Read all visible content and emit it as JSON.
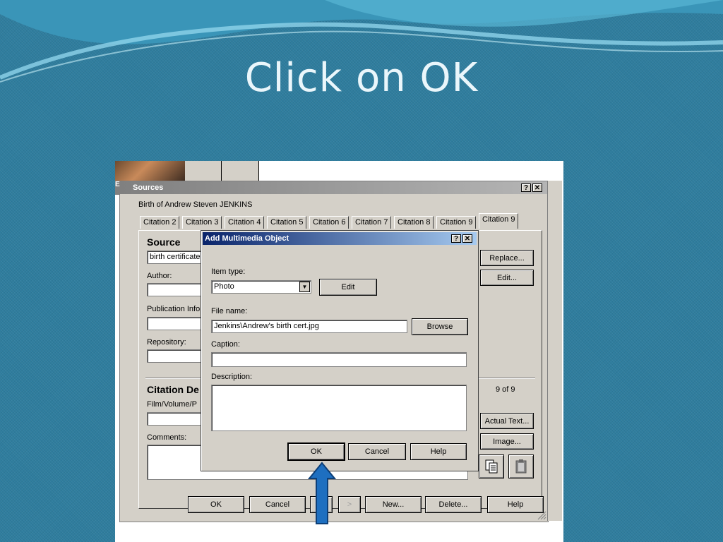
{
  "slide": {
    "title": "Click on OK"
  },
  "sources_dialog": {
    "title": "Sources",
    "help_btn": "?",
    "close_btn": "✕",
    "subtitle": "Birth of Andrew Steven JENKINS",
    "tabs": [
      "Citation 2",
      "Citation 3",
      "Citation 4",
      "Citation 5",
      "Citation 6",
      "Citation 7",
      "Citation 8",
      "Citation 9",
      "Citation 9"
    ],
    "source_heading": "Source",
    "source_value": "birth certificate",
    "author_label": "Author:",
    "publication_label": "Publication Info",
    "repository_label": "Repository:",
    "citation_heading": "Citation De",
    "film_label": "Film/Volume/P",
    "comments_label": "Comments:",
    "replace_btn": "Replace...",
    "edit_btn": "Edit...",
    "count": "9 of 9",
    "actual_text_btn": "Actual Text...",
    "image_btn": "Image...",
    "footer": {
      "ok": "OK",
      "cancel": "Cancel",
      "next": ">",
      "new": "New...",
      "delete": "Delete...",
      "help": "Help"
    },
    "side_letter": "Ed"
  },
  "multimedia_dialog": {
    "title": "Add Multimedia Object",
    "help_btn": "?",
    "close_btn": "✕",
    "item_type_label": "Item type:",
    "item_type_value": "Photo",
    "edit_btn": "Edit",
    "file_name_label": "File name:",
    "file_name_value": "Jenkins\\Andrew's birth cert.jpg",
    "browse_btn": "Browse",
    "caption_label": "Caption:",
    "caption_value": "",
    "description_label": "Description:",
    "description_value": "",
    "ok_btn": "OK",
    "cancel_btn": "Cancel",
    "help_action_btn": "Help"
  },
  "colors": {
    "background": "#2f7d9e",
    "arrow": "#1e6fc0",
    "title_text": "#eaf6fb"
  }
}
